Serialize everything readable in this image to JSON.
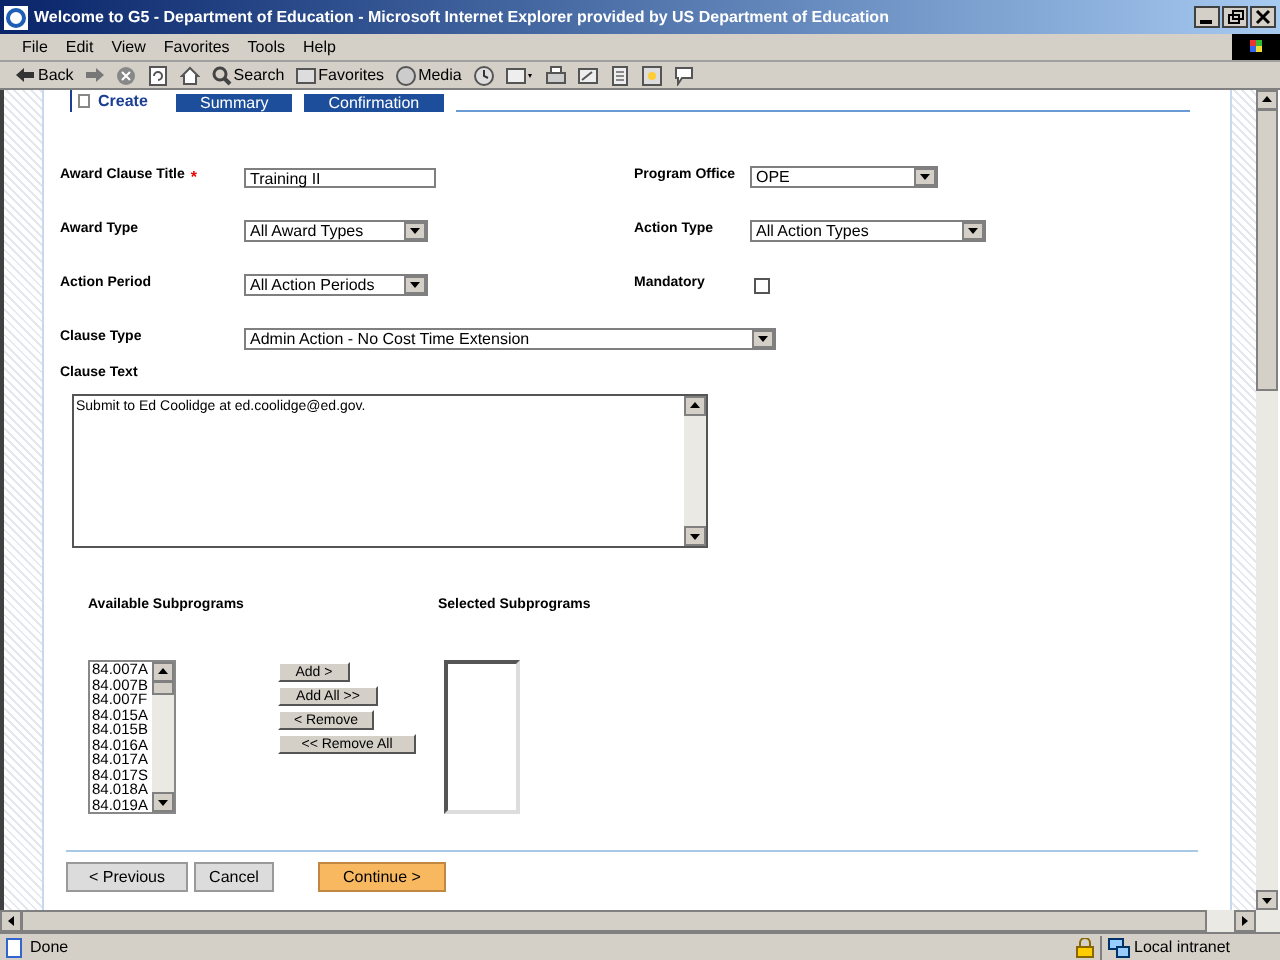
{
  "window": {
    "title": "Welcome to G5 - Department of Education - Microsoft Internet Explorer provided by US Department of Education"
  },
  "menu": [
    "File",
    "Edit",
    "View",
    "Favorites",
    "Tools",
    "Help"
  ],
  "toolbar": {
    "back": "Back",
    "search": "Search",
    "favorites": "Favorites",
    "media": "Media"
  },
  "tabs": [
    {
      "label": "Create",
      "selected": true
    },
    {
      "label": "Summary",
      "selected": false
    },
    {
      "label": "Confirmation",
      "selected": false
    }
  ],
  "form": {
    "award_clause_title": {
      "label": "Award Clause Title",
      "required_mark": "*",
      "value": "Training II"
    },
    "program_office": {
      "label": "Program Office",
      "value": "OPE"
    },
    "award_type": {
      "label": "Award Type",
      "value": "All Award Types"
    },
    "action_type": {
      "label": "Action Type",
      "value": "All Action Types"
    },
    "action_period": {
      "label": "Action Period",
      "value": "All Action Periods"
    },
    "mandatory": {
      "label": "Mandatory",
      "checked": false
    },
    "clause_type": {
      "label": "Clause Type",
      "value": "Admin Action - No Cost Time Extension"
    },
    "clause_text": {
      "label": "Clause Text",
      "value": "Submit to Ed Coolidge at ed.coolidge@ed.gov."
    }
  },
  "subprograms": {
    "available_label": "Available Subprograms",
    "selected_label": "Selected Subprograms",
    "available": [
      "84.007A",
      "84.007B",
      "84.007F",
      "84.015A",
      "84.015B",
      "84.016A",
      "84.017A",
      "84.017S",
      "84.018A",
      "84.019A"
    ],
    "buttons": [
      "Add >",
      "Add All >>",
      "< Remove",
      "<< Remove All"
    ]
  },
  "nav_buttons": [
    {
      "label": "< Previous",
      "kind": "secondary"
    },
    {
      "label": "Cancel",
      "kind": "secondary"
    },
    {
      "label": "Continue >",
      "kind": "primary"
    }
  ],
  "status_bar": {
    "text": "Done",
    "zone": "Local intranet"
  }
}
